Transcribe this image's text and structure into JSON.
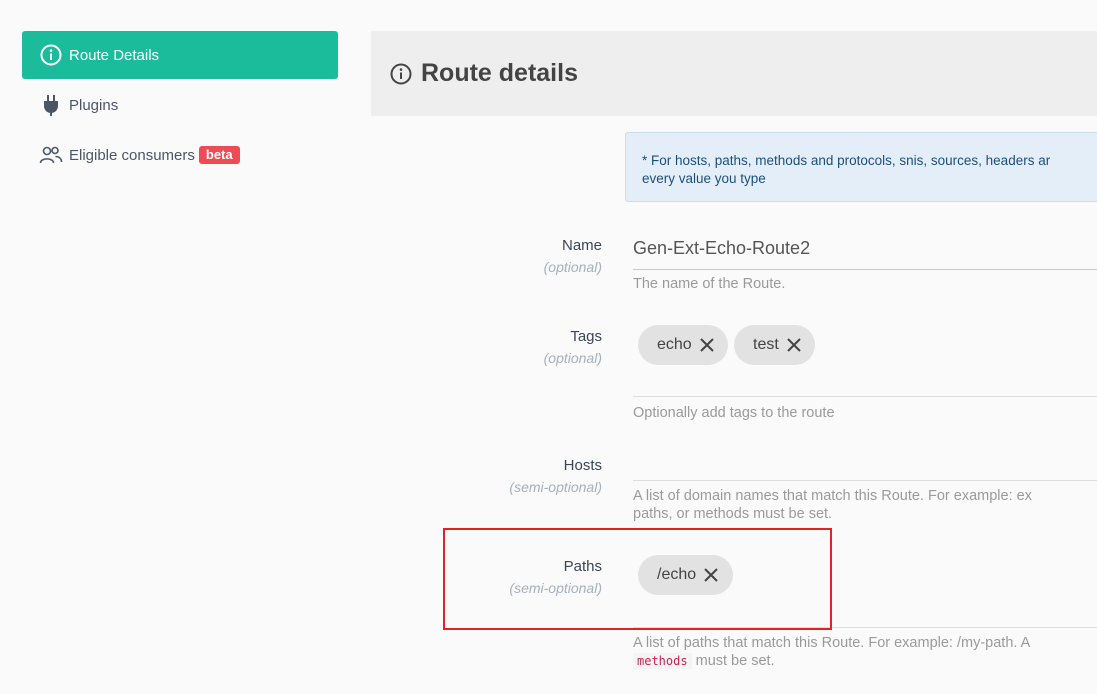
{
  "sidebar": {
    "items": [
      {
        "label": "Route Details",
        "icon": "info-icon",
        "active": true
      },
      {
        "label": "Plugins",
        "icon": "plug-icon"
      },
      {
        "label": "Eligible consumers",
        "icon": "users-icon",
        "badge": "beta"
      }
    ]
  },
  "header": {
    "title": "Route details",
    "icon": "info-icon"
  },
  "notice": {
    "line1": "* For hosts, paths, methods and protocols, snis, sources, headers ar",
    "line2": "every value you type"
  },
  "form": {
    "name": {
      "label": "Name",
      "qualifier": "(optional)",
      "value": "Gen-Ext-Echo-Route2",
      "help": "The name of the Route."
    },
    "tags": {
      "label": "Tags",
      "qualifier": "(optional)",
      "values": [
        "echo",
        "test"
      ],
      "help": "Optionally add tags to the route"
    },
    "hosts": {
      "label": "Hosts",
      "qualifier": "(semi-optional)",
      "help_line1": "A list of domain names that match this Route. For example: ex",
      "help_line2": "paths, or methods must be set."
    },
    "paths": {
      "label": "Paths",
      "qualifier": "(semi-optional)",
      "values": [
        "/echo"
      ],
      "help_line1": "A list of paths that match this Route. For example: /my-path. A",
      "help_code": "methods",
      "help_line2_rest": "must be set."
    }
  },
  "colors": {
    "accent": "#1abc9c",
    "badge": "#ef4b54",
    "highlight": "#e02424",
    "notice_bg": "#e3eef8"
  }
}
